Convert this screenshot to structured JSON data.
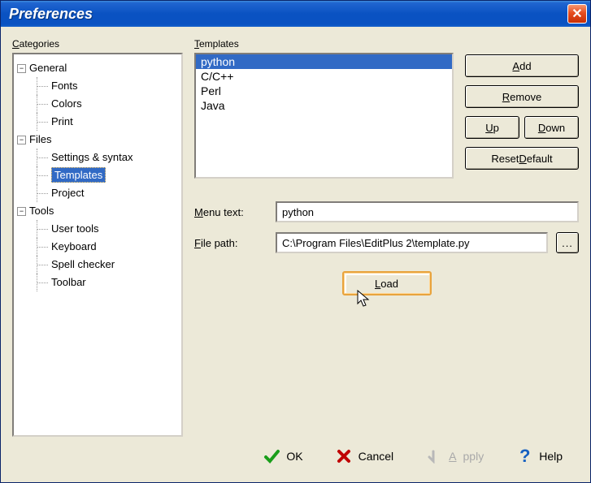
{
  "window": {
    "title": "Preferences"
  },
  "categories": {
    "label": "Categories",
    "general": {
      "label": "General",
      "fonts": "Fonts",
      "colors": "Colors",
      "print": "Print"
    },
    "files": {
      "label": "Files",
      "settings_syntax": "Settings & syntax",
      "templates": "Templates",
      "project": "Project"
    },
    "tools": {
      "label": "Tools",
      "user_tools": "User tools",
      "keyboard": "Keyboard",
      "spell_checker": "Spell checker",
      "toolbar": "Toolbar"
    }
  },
  "templates": {
    "label": "Templates",
    "items": [
      "python",
      "C/C++",
      "Perl",
      "Java"
    ],
    "buttons": {
      "add": "Add",
      "remove": "Remove",
      "up": "Up",
      "down": "Down",
      "reset_default": "Reset Default"
    }
  },
  "form": {
    "menu_text_label": "Menu text:",
    "menu_text_value": "python",
    "file_path_label": "File path:",
    "file_path_value": "C:\\Program Files\\EditPlus 2\\template.py",
    "browse": "...",
    "load": "Load"
  },
  "buttons": {
    "ok": "OK",
    "cancel": "Cancel",
    "apply": "Apply",
    "help": "Help"
  }
}
